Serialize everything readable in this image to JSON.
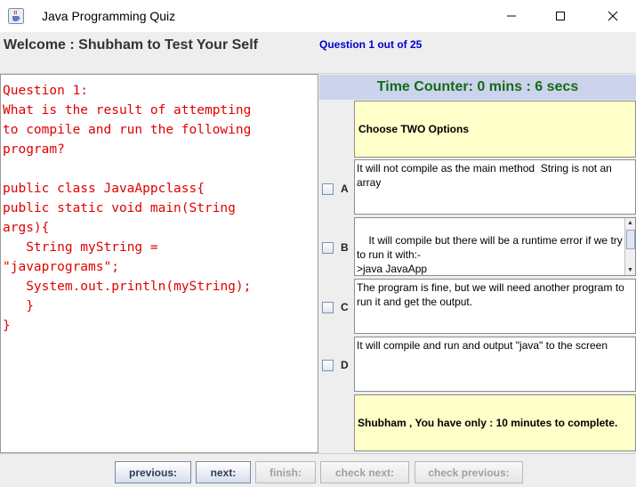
{
  "window": {
    "title": "Java Programming Quiz",
    "icon": "java-cup-icon"
  },
  "header": {
    "welcome": "Welcome : Shubham  to Test Your Self",
    "question_count": "Question 1 out of 25"
  },
  "question": {
    "text": "Question 1:\nWhat is the result of attempting\nto compile and run the following\nprogram?\n\npublic class JavaAppclass{\npublic static void main(String\nargs){\n   String myString =\n\"javaprograms\";\n   System.out.println(myString);\n   }\n}"
  },
  "timer": {
    "text": "Time Counter:  0 mins : 6 secs"
  },
  "instruction": "Choose TWO Options",
  "options": [
    {
      "letter": "A",
      "text": "It will not compile as the main method  String is not an\narray",
      "checked": false
    },
    {
      "letter": "B",
      "text": "It will compile but there will be a runtime error if we try\nto run it with:-\n>java JavaApp",
      "checked": false
    },
    {
      "letter": "C",
      "text": "The program is fine, but we will need another program to\nrun it and get the output.",
      "checked": false
    },
    {
      "letter": "D",
      "text": "It will compile and run and output \"java\" to the screen",
      "checked": false
    }
  ],
  "note": "Shubham , You have only : 10 minutes to complete.",
  "buttons": {
    "previous": "previous:",
    "next": "next:",
    "finish": "finish:",
    "check_next": "check next:",
    "check_previous": "check previous:"
  },
  "colors": {
    "question_text": "#e00000",
    "timer_bg": "#ccd3ec",
    "timer_text": "#136b13",
    "note_bg": "#ffffc9",
    "question_count": "#0000cc"
  }
}
